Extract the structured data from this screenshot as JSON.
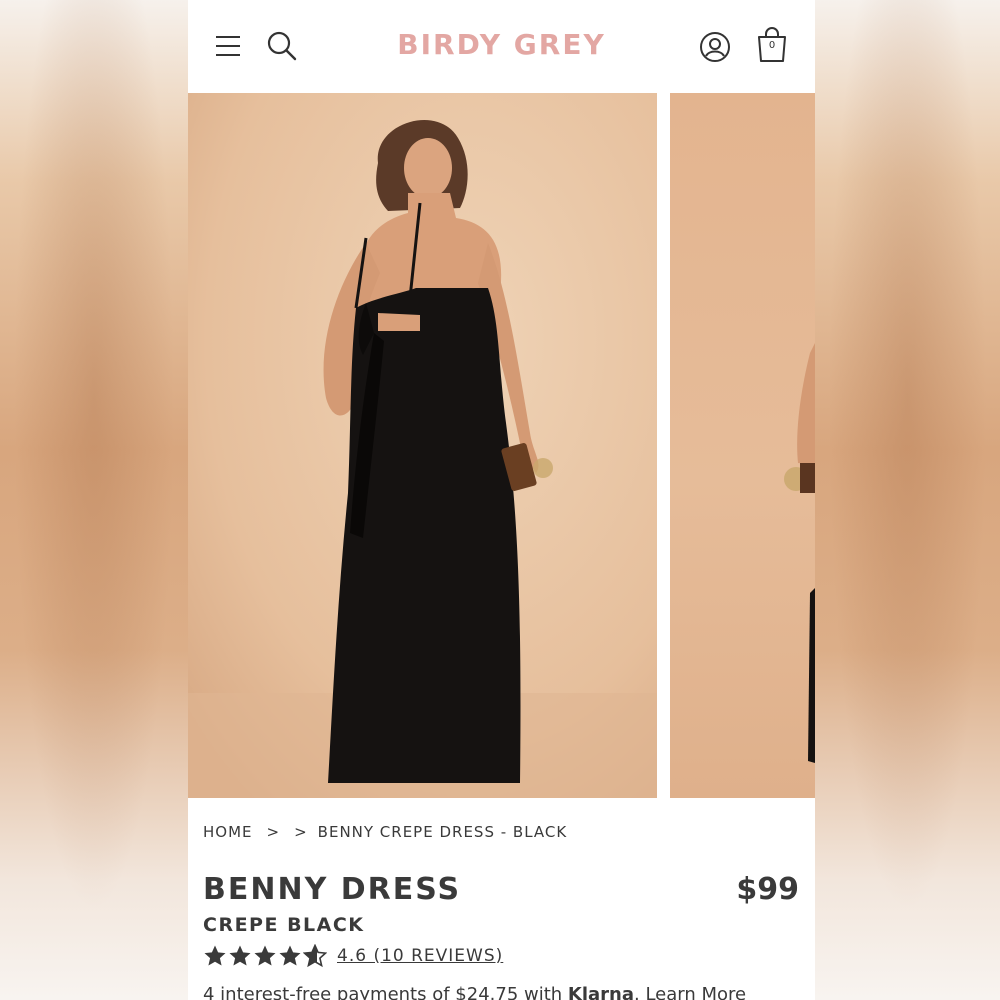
{
  "header": {
    "brand": "BIRDY GREY",
    "brand_color": "#e3a7a3",
    "icons": [
      "menu-icon",
      "search-icon",
      "account-icon",
      "shopping-bag-icon"
    ],
    "cart_count": "0"
  },
  "gallery": {
    "backdrop_color": "#e8c3a2",
    "dress_color": "#151211"
  },
  "breadcrumb": {
    "home": "HOME",
    "sep1": ">",
    "sep2": ">",
    "current": "BENNY CREPE DRESS - BLACK"
  },
  "product": {
    "title": "BENNY DRESS",
    "subtitle": "CREPE BLACK",
    "price": "$99",
    "rating": 4.6,
    "rating_text": "4.6 (10 REVIEWS)",
    "klarna_prefix": "4 interest-free payments of $24.75 with ",
    "klarna_brand": "Klarna",
    "klarna_suffix": ". Learn More"
  }
}
